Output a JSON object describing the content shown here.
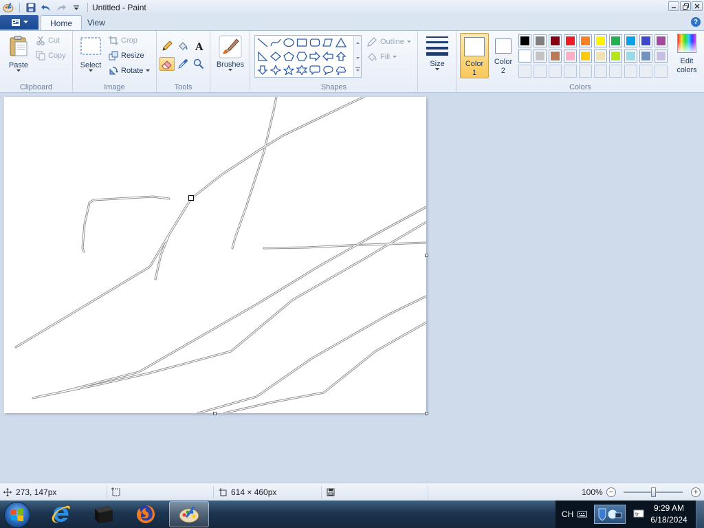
{
  "window": {
    "title": "Untitled - Paint",
    "controls": [
      "minimize",
      "restore",
      "close"
    ]
  },
  "tabs": [
    {
      "label": "Home",
      "active": true
    },
    {
      "label": "View",
      "active": false
    }
  ],
  "ribbon": {
    "clipboard": {
      "label": "Clipboard",
      "paste": "Paste",
      "cut": "Cut",
      "copy": "Copy"
    },
    "image": {
      "label": "Image",
      "select": "Select",
      "crop": "Crop",
      "resize": "Resize",
      "rotate": "Rotate"
    },
    "tools": {
      "label": "Tools",
      "items": [
        "pencil-icon",
        "fill-icon",
        "text-icon",
        "eraser-icon",
        "color-picker-icon",
        "magnifier-icon"
      ],
      "selected": "eraser-icon"
    },
    "brushes": {
      "label": "Brushes"
    },
    "shapes": {
      "label": "Shapes",
      "outline": "Outline",
      "fill": "Fill"
    },
    "size": {
      "label": "Size"
    },
    "colors": {
      "label": "Colors",
      "color1": "Color",
      "color1_num": "1",
      "color2": "Color",
      "color2_num": "2",
      "edit_colors_1": "Edit",
      "edit_colors_2": "colors",
      "color1_value": "#ffffff",
      "color2_value": "#ffffff",
      "palette_row1": [
        "#000000",
        "#7f7f7f",
        "#880015",
        "#ed1c24",
        "#ff7f27",
        "#fff200",
        "#22b14c",
        "#00a2e8",
        "#3f48cc",
        "#a349a4"
      ],
      "palette_row2": [
        "#ffffff",
        "#c3c3c3",
        "#b97a57",
        "#ffaec9",
        "#ffc90e",
        "#efe4b0",
        "#b5e61d",
        "#99d9ea",
        "#7092be",
        "#c8bfe7"
      ],
      "palette_row3_count": "10"
    }
  },
  "status": {
    "cursor_pos": "273, 147px",
    "canvas_size": "614 × 460px",
    "zoom": "100%",
    "zoom_fraction": 0.5
  },
  "taskbar": {
    "items": [
      "internet-explorer-icon",
      "command-prompt-icon",
      "firefox-icon",
      "paint-icon"
    ],
    "active": "paint-icon",
    "lang": "CH",
    "time": "9:29 AM",
    "date": "6/18/2024"
  }
}
